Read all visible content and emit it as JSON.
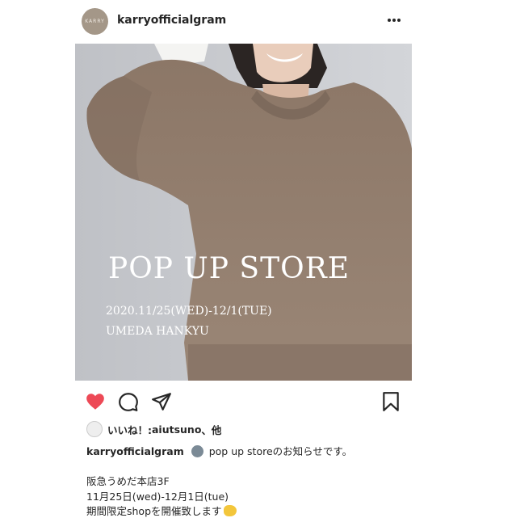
{
  "post": {
    "username": "karryofficialgram",
    "avatar_text": "KARRY",
    "image": {
      "title": "POP UP STORE",
      "dates": "2020.11/25(WED)-12/1(TUE)",
      "location": "UMEDA HANKYU"
    },
    "likes": {
      "prefix": "いいね！: ",
      "user": "aiutsuno",
      "suffix": "、他"
    },
    "caption": {
      "username": "karryofficialgram",
      "first_line": "pop up storeのお知らせです。",
      "lines": [
        "阪急うめだ本店3F",
        "11月25日(wed)-12月1日(tue)",
        "期間限定shopを開催致します"
      ]
    }
  },
  "icons": {
    "more": "more-icon",
    "like": "heart-icon",
    "comment": "comment-icon",
    "share": "share-icon",
    "save": "bookmark-icon"
  },
  "colors": {
    "like_active": "#ed4956",
    "text": "#262626",
    "background": "#ffffff"
  }
}
